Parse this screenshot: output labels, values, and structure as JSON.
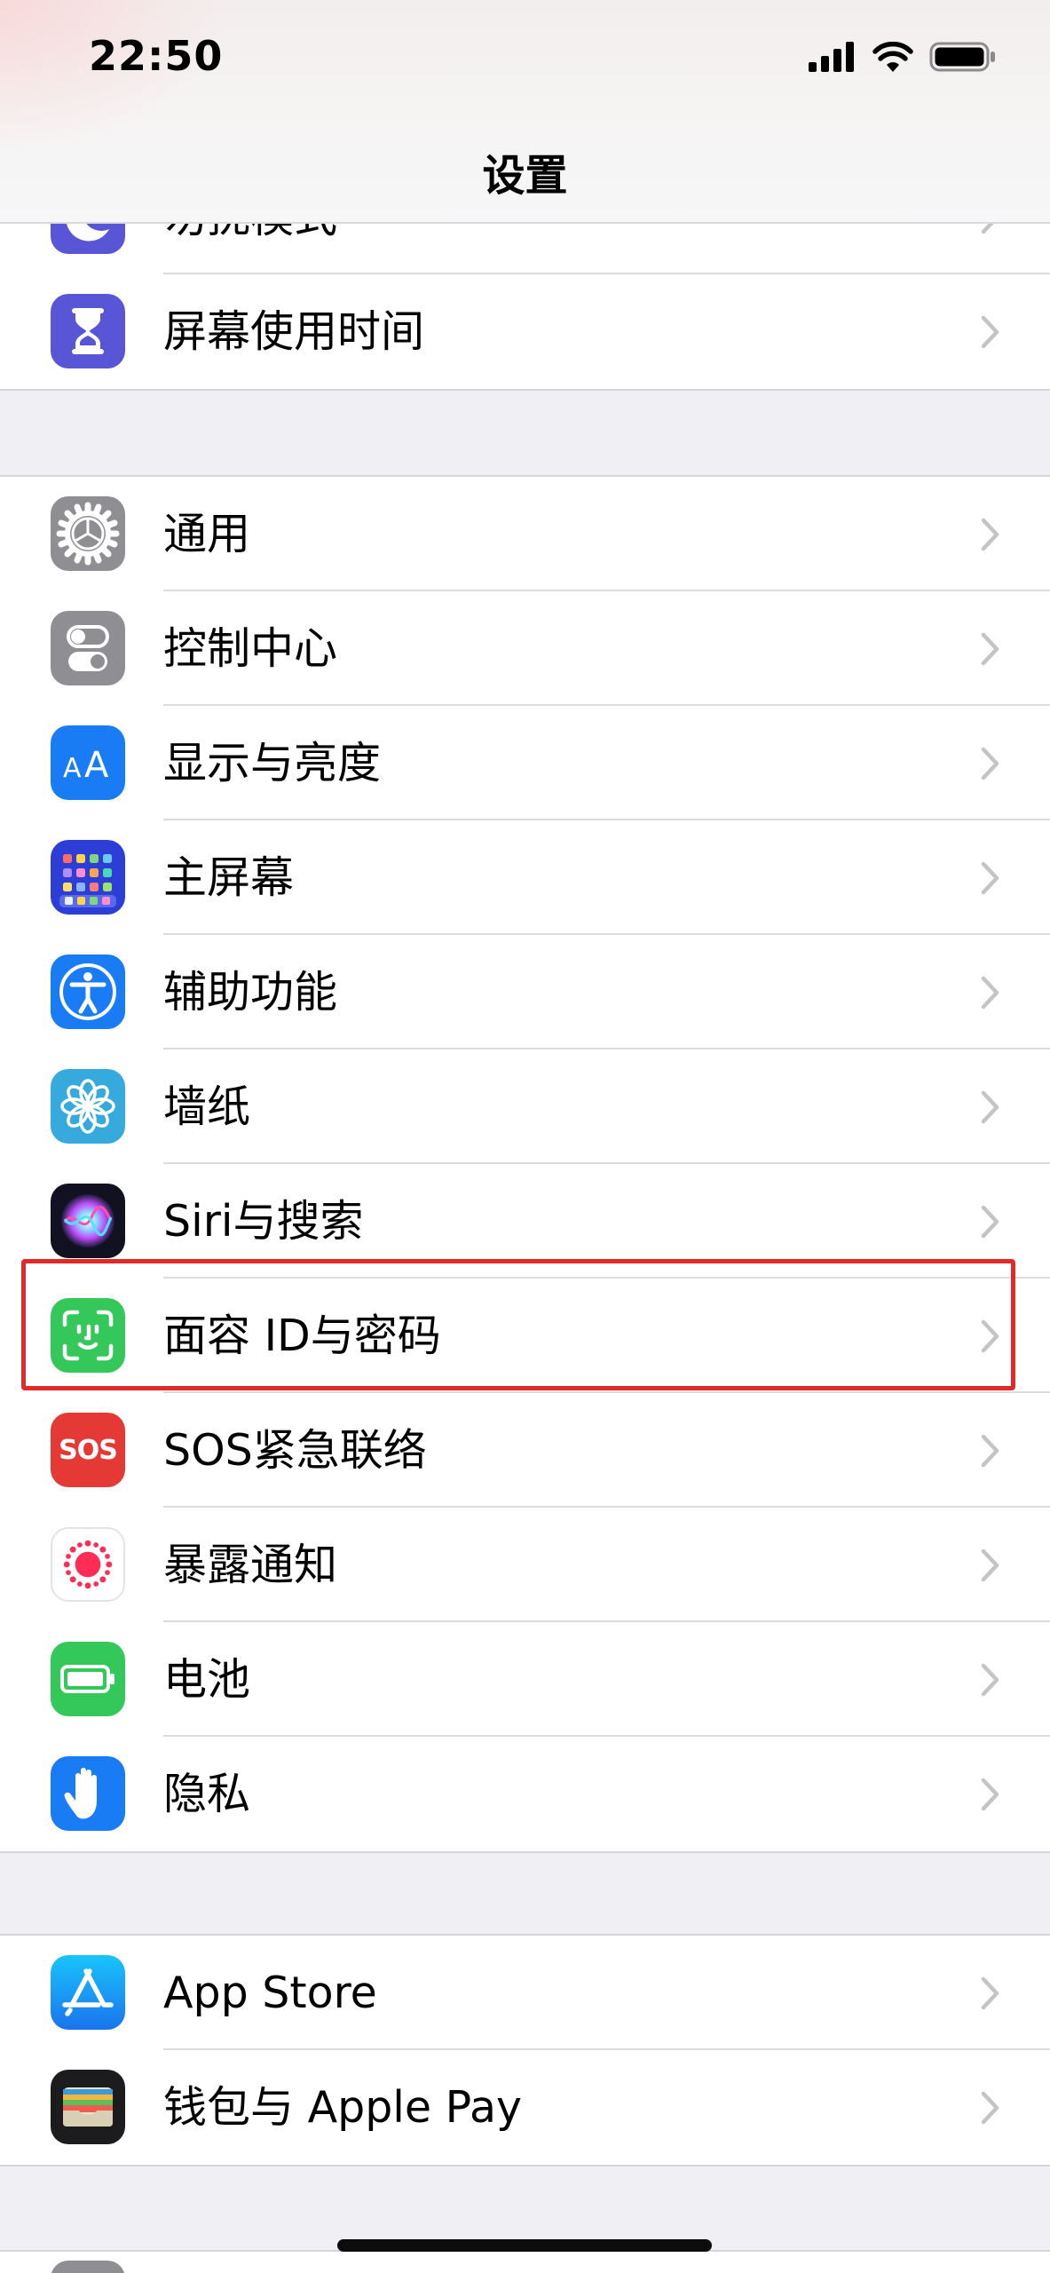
{
  "status_bar": {
    "time": "22:50",
    "icons": [
      "cellular-signal-icon",
      "wifi-icon",
      "battery-icon"
    ]
  },
  "nav": {
    "title": "设置"
  },
  "groups": {
    "top": {
      "items": [
        {
          "label": "勿扰模式",
          "icon": "moon-icon",
          "color": "#5856d6"
        },
        {
          "label": "屏幕使用时间",
          "icon": "hourglass-icon",
          "color": "#5856d6"
        }
      ]
    },
    "system": {
      "items": [
        {
          "label": "通用",
          "icon": "gear-icon",
          "color": "#8e8e93"
        },
        {
          "label": "控制中心",
          "icon": "toggles-icon",
          "color": "#8e8e93"
        },
        {
          "label": "显示与亮度",
          "icon": "text-size-icon",
          "color": "#1a7cf5"
        },
        {
          "label": "主屏幕",
          "icon": "home-grid-icon",
          "color": "#2c3ed6"
        },
        {
          "label": "辅助功能",
          "icon": "accessibility-icon",
          "color": "#1a7cf5"
        },
        {
          "label": "墙纸",
          "icon": "flower-icon",
          "color": "#36aadc"
        },
        {
          "label": "Siri与搜索",
          "icon": "siri-icon",
          "color": "#1b1b3a"
        },
        {
          "label": "面容 ID与密码",
          "icon": "face-id-icon",
          "color": "#34c759"
        },
        {
          "label": "SOS紧急联络",
          "icon": "sos-icon",
          "color": "#e53935"
        },
        {
          "label": "暴露通知",
          "icon": "exposure-icon",
          "color": "#ff2d55"
        },
        {
          "label": "电池",
          "icon": "battery-icon",
          "color": "#34c759"
        },
        {
          "label": "隐私",
          "icon": "hand-icon",
          "color": "#1a7cf5"
        }
      ]
    },
    "apps": {
      "items": [
        {
          "label": "App Store",
          "icon": "app-store-icon",
          "color": "#1a8cf0"
        },
        {
          "label": "钱包与 Apple Pay",
          "icon": "wallet-icon",
          "color": "#1c1c1e"
        }
      ]
    }
  },
  "sos_icon_text": "SOS",
  "highlighted_item": "面容 ID与密码"
}
